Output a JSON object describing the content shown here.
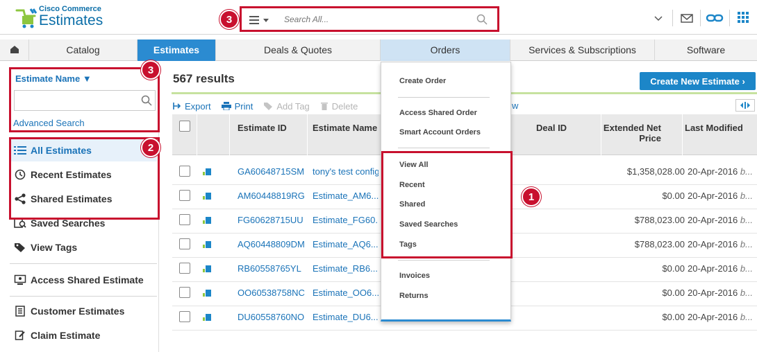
{
  "app": {
    "brand_small": "Cisco Commerce",
    "brand_title": "Estimates"
  },
  "search": {
    "placeholder": "Search All...",
    "menu_icon": "hamburger-menu-icon",
    "search_icon": "magnifier-icon"
  },
  "header_icons": [
    "chevron-down-icon",
    "mail-icon",
    "link-icon",
    "apps-grid-icon"
  ],
  "nav": {
    "home_icon": "home-icon",
    "tabs": [
      {
        "label": "Catalog"
      },
      {
        "label": "Estimates"
      },
      {
        "label": "Deals & Quotes"
      },
      {
        "label": "Orders"
      },
      {
        "label": "Services & Subscriptions"
      },
      {
        "label": "Software"
      }
    ]
  },
  "sidebar": {
    "filter_label": "Estimate Name ▼",
    "advanced_search": "Advanced Search",
    "items": [
      {
        "label": "All Estimates",
        "icon": "list-icon"
      },
      {
        "label": "Recent Estimates",
        "icon": "clock-icon"
      },
      {
        "label": "Shared Estimates",
        "icon": "share-icon"
      },
      {
        "label": "Saved Searches",
        "icon": "saved-search-icon"
      },
      {
        "label": "View Tags",
        "icon": "tag-icon"
      },
      {
        "label": "Access Shared Estimate",
        "icon": "monitor-icon"
      },
      {
        "label": "Customer Estimates",
        "icon": "document-icon"
      },
      {
        "label": "Claim Estimate",
        "icon": "claim-icon"
      }
    ]
  },
  "main": {
    "results": "567 results",
    "create_button": "Create New Estimate  ›",
    "toolbar": {
      "export": "Export",
      "print": "Print",
      "add_tag": "Add Tag",
      "delete": "Delete",
      "view_suffix": "w"
    },
    "columns": {
      "estimate_id": "Estimate ID",
      "estimate_name": "Estimate Name",
      "deal_id": "Deal ID",
      "extended_net_price": "Extended Net Price",
      "last_modified": "Last Modified"
    },
    "rows": [
      {
        "id": "GA60648715SM",
        "name": "tony's test config",
        "price": "$1,358,028.00",
        "date": "20-Apr-2016",
        "by": "b..."
      },
      {
        "id": "AM60448819RG",
        "name": "Estimate_AM6...",
        "price": "$0.00",
        "date": "20-Apr-2016",
        "by": "b..."
      },
      {
        "id": "FG60628715UU",
        "name": "Estimate_FG60...",
        "price": "$788,023.00",
        "date": "20-Apr-2016",
        "by": "b..."
      },
      {
        "id": "AQ60448809DM",
        "name": "Estimate_AQ6...",
        "price": "$788,023.00",
        "date": "20-Apr-2016",
        "by": "b..."
      },
      {
        "id": "RB60558765YL",
        "name": "Estimate_RB6...",
        "price": "$0.00",
        "date": "20-Apr-2016",
        "by": "b..."
      },
      {
        "id": "OO60538758NC",
        "name": "Estimate_OO6...",
        "price": "$0.00",
        "date": "20-Apr-2016",
        "by": "b..."
      },
      {
        "id": "DU60558760NO",
        "name": "Estimate_DU6...",
        "price": "$0.00",
        "date": "20-Apr-2016",
        "by": "b..."
      }
    ]
  },
  "orders_menu": {
    "items": [
      "Create Order",
      "Access Shared Order",
      "Smart Account Orders",
      "View All",
      "Recent",
      "Shared",
      "Saved Searches",
      "Tags",
      "Invoices",
      "Returns"
    ]
  },
  "callouts": [
    "1",
    "2",
    "3",
    "3"
  ],
  "colors": {
    "primary": "#1c86c8",
    "active_tab": "#2b8bd1",
    "callout_red": "#c8102e",
    "link": "#1a73b8"
  }
}
